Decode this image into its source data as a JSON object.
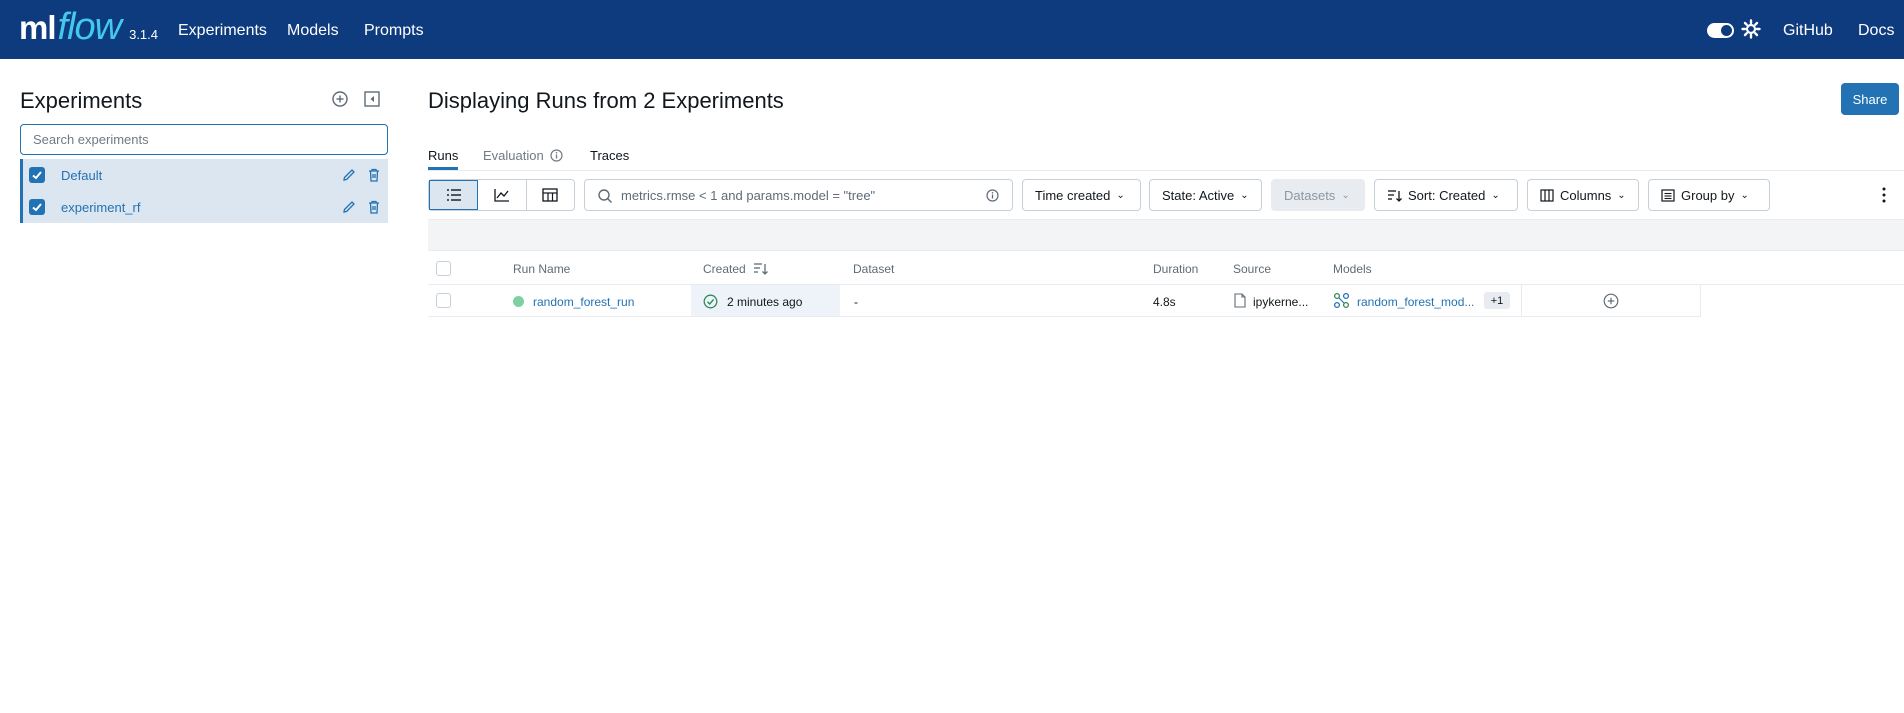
{
  "app": {
    "logo_ml": "ml",
    "logo_flow": "flow",
    "version": "3.1.4",
    "nav": [
      "Experiments",
      "Models",
      "Prompts"
    ],
    "github": "GitHub",
    "docs": "Docs"
  },
  "sidebar": {
    "title": "Experiments",
    "search_placeholder": "Search experiments",
    "experiments": [
      {
        "name": "Default",
        "checked": true
      },
      {
        "name": "experiment_rf",
        "checked": true
      }
    ]
  },
  "main": {
    "title": "Displaying Runs from 2 Experiments",
    "share_label": "Share",
    "tabs": {
      "runs": "Runs",
      "evaluation": "Evaluation",
      "traces": "Traces"
    },
    "filter_text": "metrics.rmse < 1 and params.model = \"tree\"",
    "buttons": {
      "time_created": "Time created",
      "state": "State: Active",
      "datasets": "Datasets",
      "sort": "Sort: Created",
      "columns": "Columns",
      "group_by": "Group by"
    }
  },
  "table": {
    "headers": {
      "run_name": "Run Name",
      "created": "Created",
      "dataset": "Dataset",
      "duration": "Duration",
      "source": "Source",
      "models": "Models"
    },
    "rows": [
      {
        "run_name": "random_forest_run",
        "created": "2 minutes ago",
        "dataset": "-",
        "duration": "4.8s",
        "source": "ipykerne...",
        "model": "random_forest_mod...",
        "extra_models": "+1"
      }
    ]
  },
  "colors": {
    "header_bg": "#0e3a7e",
    "accent": "#2272b4",
    "status_finished": "#7ed0a0"
  }
}
